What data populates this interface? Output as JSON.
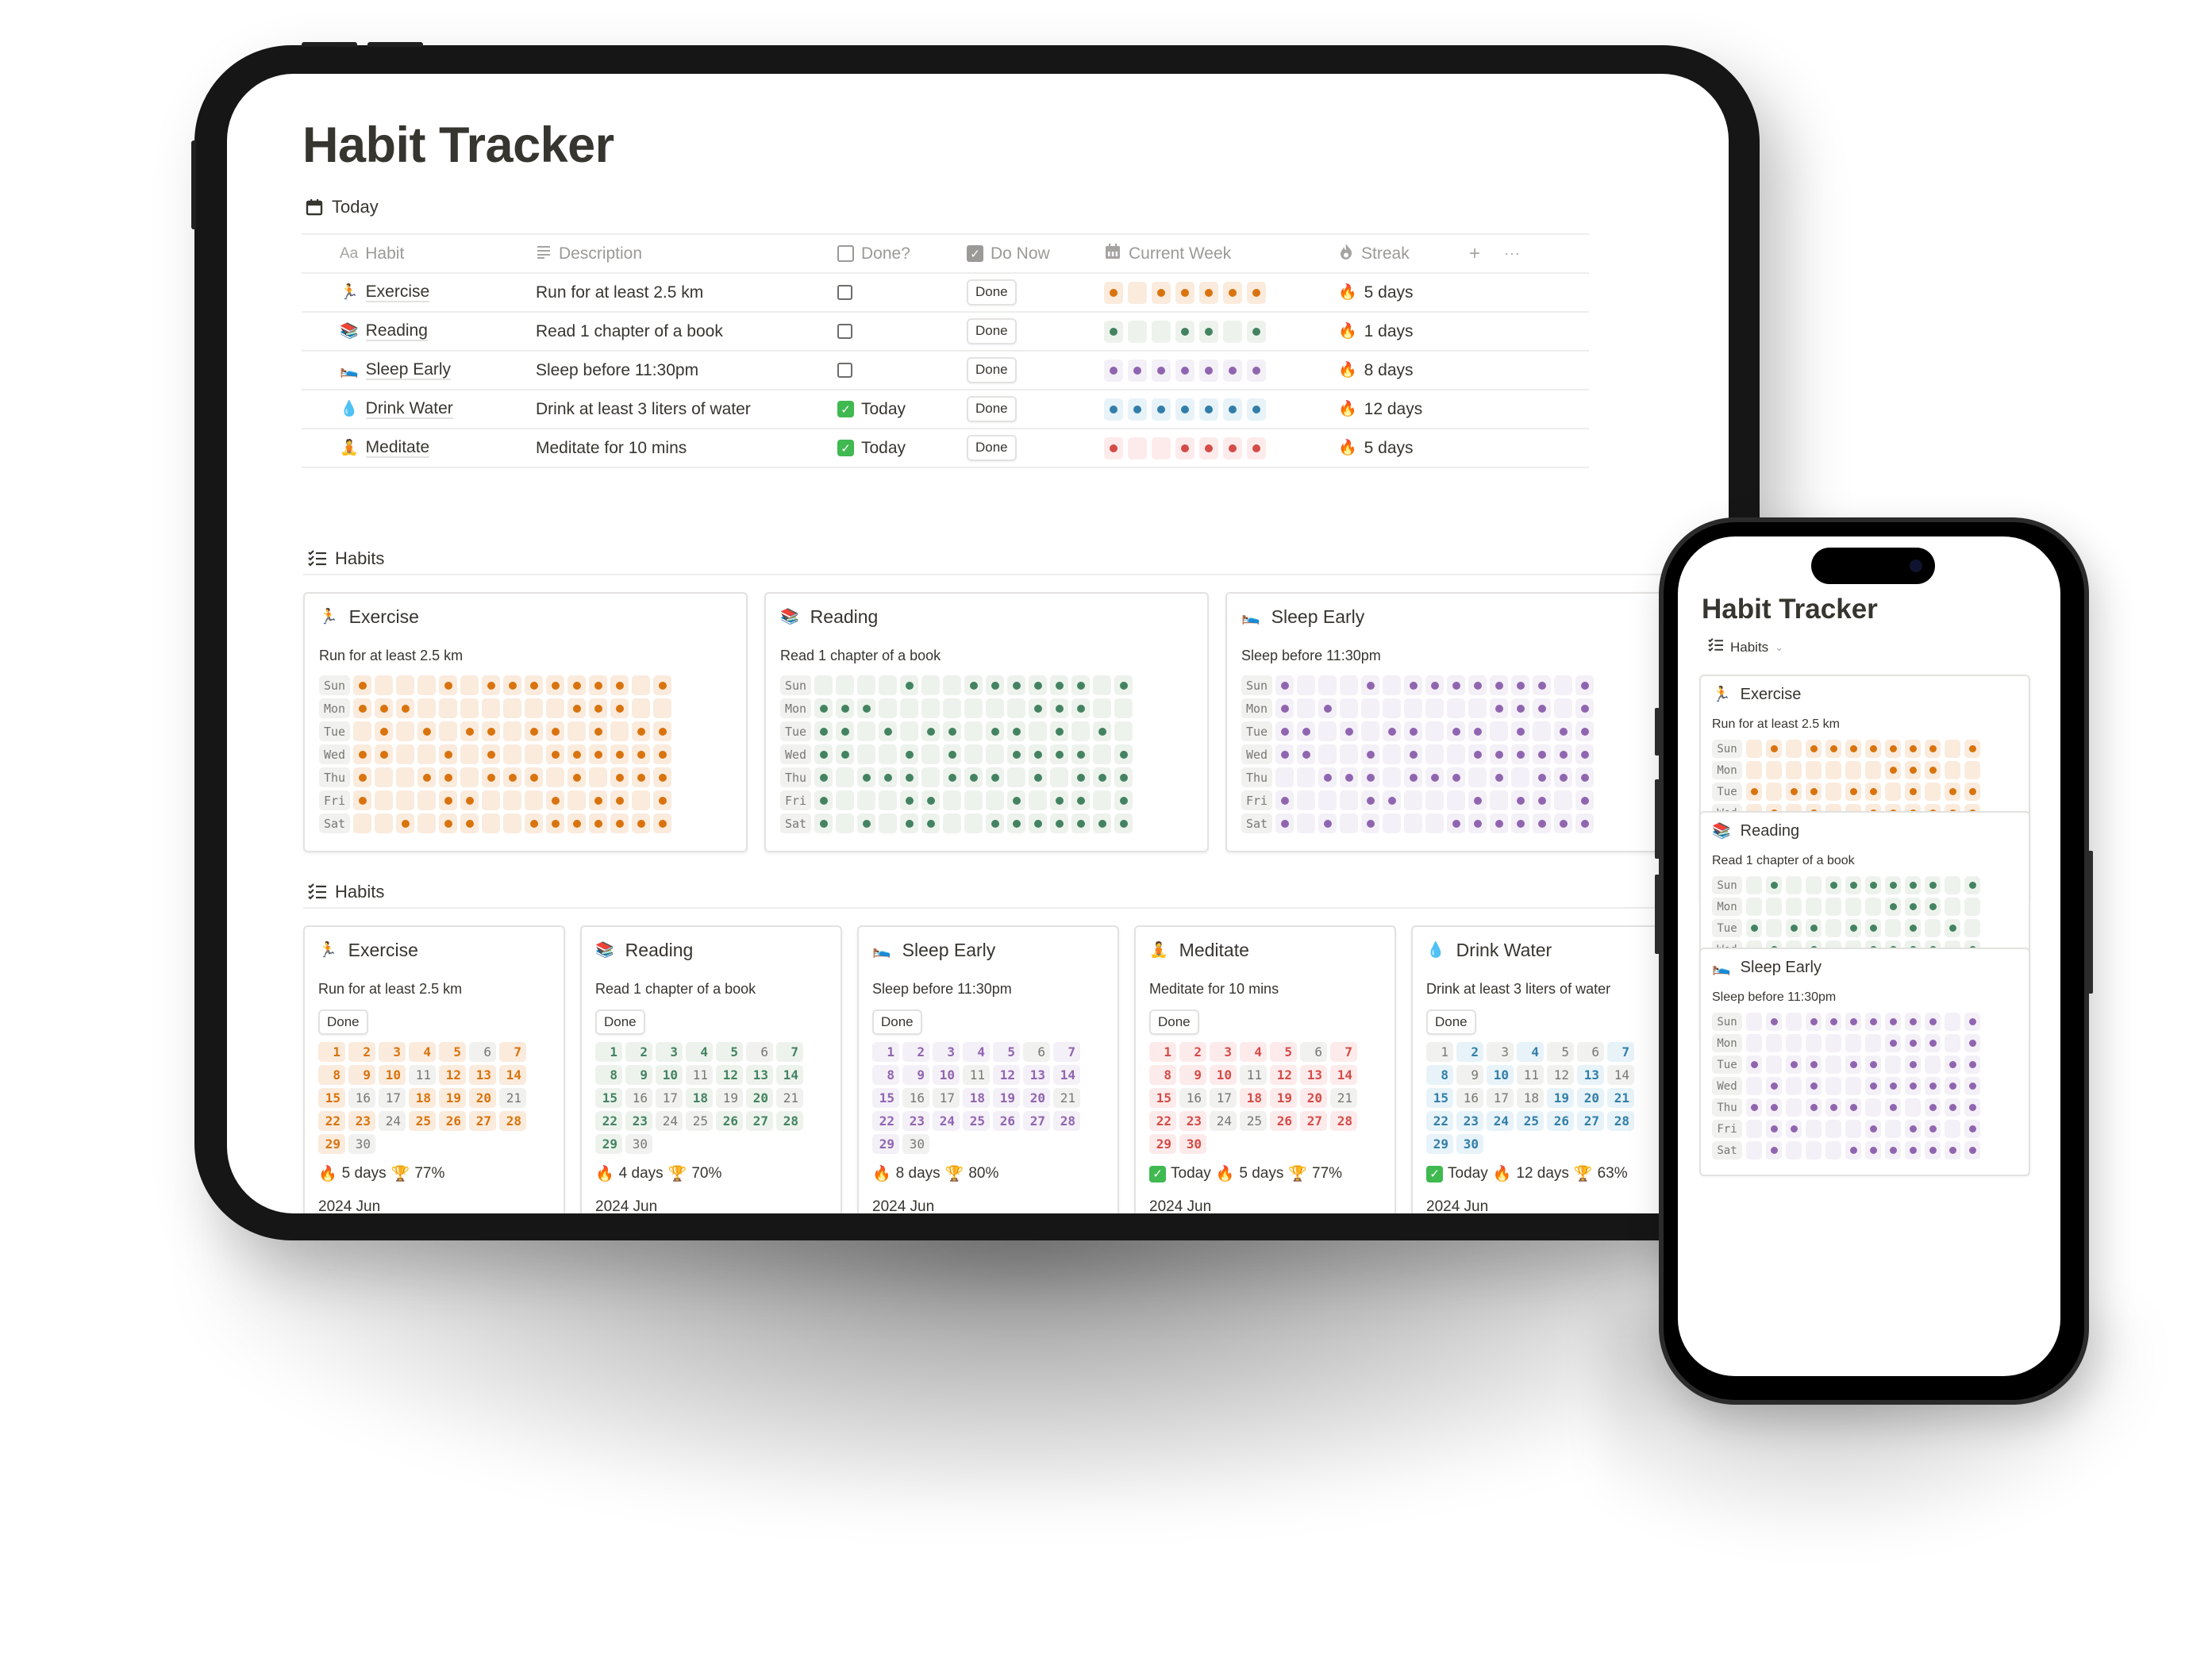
{
  "app_title": "Habit Tracker",
  "colors": {
    "orange": {
      "dot": "#d9730d",
      "bg": "#faebdd",
      "text": "#d9730d"
    },
    "green": {
      "dot": "#448361",
      "bg": "#edf3ec",
      "text": "#448361"
    },
    "purple": {
      "dot": "#9065b0",
      "bg": "#f4f0f7",
      "text": "#9065b0"
    },
    "blue": {
      "dot": "#337ea9",
      "bg": "#e7f3f8",
      "text": "#337ea9"
    },
    "red": {
      "dot": "#d44c47",
      "bg": "#fdebec",
      "text": "#d44c47"
    },
    "neutral_bg": "#f1f1ef",
    "neutral_text": "#787774"
  },
  "today": {
    "section_label": "Today",
    "section_icon": "calendar-icon",
    "columns": [
      {
        "key": "habit",
        "label": "Habit",
        "icon": "Aa"
      },
      {
        "key": "description",
        "label": "Description",
        "icon": "lines-icon"
      },
      {
        "key": "done",
        "label": "Done?",
        "icon": "checkbox-icon"
      },
      {
        "key": "do_now",
        "label": "Do Now",
        "icon": "checked-box-icon"
      },
      {
        "key": "current_week",
        "label": "Current Week",
        "icon": "calendar-grid-icon"
      },
      {
        "key": "streak",
        "label": "Streak",
        "icon": "fire-icon"
      }
    ],
    "add_column": "+",
    "more": "···",
    "rows": [
      {
        "emoji": "🏃",
        "habit": "Exercise",
        "description": "Run for at least 2.5 km",
        "done": false,
        "done_label": "",
        "do_now": "Done",
        "color": "orange",
        "week": [
          1,
          0,
          1,
          1,
          1,
          1,
          1
        ],
        "streak": "5 days"
      },
      {
        "emoji": "📚",
        "habit": "Reading",
        "description": "Read 1 chapter of a book",
        "done": false,
        "done_label": "",
        "do_now": "Done",
        "color": "green",
        "week": [
          1,
          0,
          0,
          1,
          1,
          0,
          1
        ],
        "streak": "1 days"
      },
      {
        "emoji": "🛌",
        "habit": "Sleep Early",
        "description": "Sleep before 11:30pm",
        "done": false,
        "done_label": "",
        "do_now": "Done",
        "color": "purple",
        "week": [
          1,
          1,
          1,
          1,
          1,
          1,
          1
        ],
        "streak": "8 days"
      },
      {
        "emoji": "💧",
        "habit": "Drink Water",
        "description": "Drink at least 3 liters of water",
        "done": true,
        "done_label": "Today",
        "do_now": "Done",
        "color": "blue",
        "week": [
          1,
          1,
          1,
          1,
          1,
          1,
          1
        ],
        "streak": "12 days"
      },
      {
        "emoji": "🧘",
        "habit": "Meditate",
        "description": "Meditate for 10 mins",
        "done": true,
        "done_label": "Today",
        "do_now": "Done",
        "color": "red",
        "week": [
          1,
          0,
          0,
          1,
          1,
          1,
          1
        ],
        "streak": "5 days"
      }
    ]
  },
  "habits_grid": {
    "section_label": "Habits",
    "weekdays": [
      "Sun",
      "Mon",
      "Tue",
      "Wed",
      "Thu",
      "Fri",
      "Sat"
    ],
    "cards": [
      {
        "emoji": "🏃",
        "title": "Exercise",
        "description": "Run for at least 2.5 km",
        "color": "orange",
        "grid": [
          [
            1,
            0,
            0,
            0,
            1,
            0,
            1,
            1,
            1,
            1,
            1,
            1,
            1,
            0,
            1
          ],
          [
            1,
            1,
            1,
            0,
            0,
            0,
            0,
            0,
            0,
            0,
            1,
            1,
            1,
            0,
            0
          ],
          [
            0,
            1,
            0,
            1,
            0,
            1,
            1,
            0,
            1,
            1,
            0,
            1,
            0,
            1,
            1
          ],
          [
            1,
            1,
            0,
            0,
            1,
            0,
            1,
            0,
            0,
            1,
            1,
            1,
            1,
            1,
            1
          ],
          [
            1,
            0,
            0,
            1,
            1,
            0,
            1,
            1,
            1,
            0,
            1,
            0,
            1,
            1,
            1
          ],
          [
            1,
            0,
            0,
            0,
            1,
            1,
            0,
            0,
            0,
            1,
            0,
            1,
            1,
            0,
            1
          ],
          [
            0,
            0,
            1,
            0,
            1,
            1,
            0,
            0,
            1,
            1,
            1,
            1,
            1,
            1,
            1
          ]
        ]
      },
      {
        "emoji": "📚",
        "title": "Reading",
        "description": "Read 1 chapter of a book",
        "color": "green",
        "grid": [
          [
            0,
            0,
            0,
            0,
            1,
            0,
            0,
            1,
            1,
            1,
            1,
            1,
            1,
            0,
            1
          ],
          [
            1,
            1,
            1,
            0,
            0,
            0,
            0,
            0,
            0,
            0,
            1,
            1,
            1,
            0,
            0
          ],
          [
            1,
            1,
            0,
            1,
            0,
            1,
            1,
            0,
            1,
            1,
            0,
            1,
            0,
            1,
            0
          ],
          [
            1,
            1,
            0,
            0,
            1,
            0,
            1,
            0,
            0,
            1,
            1,
            1,
            1,
            0,
            1
          ],
          [
            1,
            0,
            1,
            1,
            1,
            0,
            1,
            1,
            1,
            0,
            1,
            0,
            1,
            1,
            1
          ],
          [
            1,
            0,
            0,
            0,
            1,
            1,
            0,
            0,
            0,
            1,
            0,
            1,
            1,
            0,
            1
          ],
          [
            1,
            0,
            1,
            0,
            1,
            1,
            0,
            0,
            1,
            1,
            1,
            1,
            1,
            1,
            1
          ]
        ]
      },
      {
        "emoji": "🛌",
        "title": "Sleep Early",
        "description": "Sleep before 11:30pm",
        "color": "purple",
        "grid": [
          [
            1,
            0,
            0,
            0,
            1,
            0,
            1,
            1,
            1,
            1,
            1,
            1,
            1,
            0,
            1
          ],
          [
            1,
            0,
            1,
            0,
            0,
            0,
            0,
            0,
            0,
            0,
            1,
            1,
            1,
            0,
            1
          ],
          [
            1,
            1,
            0,
            1,
            0,
            1,
            1,
            0,
            1,
            1,
            0,
            1,
            0,
            1,
            1
          ],
          [
            1,
            1,
            0,
            0,
            1,
            0,
            1,
            0,
            0,
            1,
            1,
            1,
            1,
            1,
            1
          ],
          [
            0,
            0,
            1,
            1,
            1,
            0,
            1,
            1,
            1,
            0,
            1,
            0,
            1,
            1,
            1
          ],
          [
            1,
            0,
            0,
            0,
            1,
            1,
            0,
            0,
            0,
            1,
            0,
            1,
            1,
            0,
            1
          ],
          [
            1,
            0,
            1,
            0,
            1,
            0,
            0,
            0,
            1,
            1,
            1,
            1,
            1,
            1,
            1
          ]
        ]
      }
    ]
  },
  "habits_calendar": {
    "section_label": "Habits",
    "button_label": "Done",
    "month_label": "2024 Jun",
    "days_in_month": 30,
    "cards": [
      {
        "emoji": "🏃",
        "title": "Exercise",
        "description": "Run for at least 2.5 km",
        "color": "orange",
        "done_days": [
          1,
          2,
          3,
          4,
          5,
          7,
          8,
          9,
          10,
          12,
          13,
          14,
          15,
          18,
          19,
          20,
          22,
          23,
          25,
          26,
          27,
          28,
          29
        ],
        "today_label": "",
        "streak": "5 days",
        "rate": "77%"
      },
      {
        "emoji": "📚",
        "title": "Reading",
        "description": "Read 1 chapter of a book",
        "color": "green",
        "done_days": [
          1,
          2,
          3,
          4,
          5,
          7,
          8,
          9,
          10,
          12,
          13,
          14,
          15,
          18,
          20,
          22,
          23,
          26,
          27,
          28,
          29
        ],
        "today_label": "",
        "streak": "4 days",
        "rate": "70%"
      },
      {
        "emoji": "🛌",
        "title": "Sleep Early",
        "description": "Sleep before 11:30pm",
        "color": "purple",
        "done_days": [
          1,
          2,
          3,
          4,
          5,
          7,
          8,
          9,
          10,
          12,
          13,
          14,
          15,
          18,
          19,
          20,
          22,
          23,
          24,
          25,
          26,
          27,
          28,
          29
        ],
        "today_label": "",
        "streak": "8 days",
        "rate": "80%"
      },
      {
        "emoji": "🧘",
        "title": "Meditate",
        "description": "Meditate for 10 mins",
        "color": "red",
        "done_days": [
          1,
          2,
          3,
          4,
          5,
          7,
          8,
          9,
          10,
          12,
          13,
          14,
          15,
          18,
          19,
          20,
          22,
          23,
          26,
          27,
          28,
          29,
          30
        ],
        "today_label": "Today",
        "streak": "5 days",
        "rate": "77%"
      },
      {
        "emoji": "💧",
        "title": "Drink Water",
        "description": "Drink at least 3 liters of water",
        "color": "blue",
        "done_days": [
          2,
          4,
          7,
          8,
          10,
          13,
          15,
          19,
          20,
          21,
          22,
          23,
          24,
          25,
          26,
          27,
          28,
          29,
          30
        ],
        "today_label": "Today",
        "streak": "12 days",
        "rate": "63%"
      }
    ]
  },
  "phone": {
    "title": "Habit Tracker",
    "view_label": "Habits",
    "cards": [
      {
        "emoji": "🏃",
        "title": "Exercise",
        "description": "Run for at least 2.5 km",
        "color": "orange",
        "grid": [
          [
            0,
            1,
            0,
            1,
            1,
            1,
            1,
            1,
            1,
            1,
            0,
            1
          ],
          [
            0,
            0,
            0,
            0,
            0,
            0,
            0,
            1,
            1,
            1,
            0,
            0
          ],
          [
            1,
            0,
            1,
            1,
            0,
            1,
            1,
            0,
            1,
            0,
            1,
            1
          ],
          [
            0,
            1,
            0,
            1,
            0,
            0,
            1,
            1,
            1,
            1,
            1,
            1
          ],
          [
            1,
            1,
            0,
            1,
            1,
            1,
            0,
            1,
            0,
            1,
            1,
            1
          ],
          [
            0,
            1,
            1,
            0,
            0,
            0,
            1,
            0,
            1,
            1,
            0,
            1
          ],
          [
            0,
            1,
            1,
            0,
            0,
            1,
            1,
            1,
            1,
            1,
            1,
            1
          ]
        ]
      },
      {
        "emoji": "📚",
        "title": "Reading",
        "description": "Read 1 chapter of a book",
        "color": "green",
        "grid": [
          [
            0,
            1,
            0,
            0,
            1,
            1,
            1,
            1,
            1,
            1,
            0,
            1
          ],
          [
            0,
            0,
            0,
            0,
            0,
            0,
            0,
            1,
            1,
            1,
            0,
            0
          ],
          [
            1,
            0,
            1,
            1,
            0,
            1,
            1,
            0,
            1,
            0,
            1,
            0
          ],
          [
            0,
            1,
            0,
            1,
            0,
            0,
            1,
            1,
            1,
            1,
            0,
            1
          ],
          [
            1,
            1,
            0,
            1,
            1,
            1,
            0,
            1,
            0,
            1,
            1,
            1
          ],
          [
            0,
            1,
            1,
            0,
            0,
            0,
            1,
            0,
            1,
            1,
            0,
            0
          ],
          [
            0,
            1,
            1,
            0,
            0,
            1,
            1,
            1,
            1,
            1,
            1,
            1
          ]
        ]
      },
      {
        "emoji": "🛌",
        "title": "Sleep Early",
        "description": "Sleep before 11:30pm",
        "color": "purple",
        "grid": [
          [
            0,
            1,
            0,
            1,
            1,
            1,
            1,
            1,
            1,
            1,
            0,
            1
          ],
          [
            0,
            0,
            0,
            0,
            0,
            0,
            0,
            1,
            1,
            1,
            0,
            1
          ],
          [
            1,
            0,
            1,
            1,
            0,
            1,
            1,
            0,
            1,
            0,
            1,
            1
          ],
          [
            0,
            1,
            0,
            1,
            0,
            0,
            1,
            1,
            1,
            1,
            1,
            1
          ],
          [
            1,
            1,
            0,
            1,
            1,
            1,
            0,
            1,
            0,
            1,
            1,
            1
          ],
          [
            0,
            1,
            1,
            0,
            0,
            0,
            1,
            0,
            1,
            1,
            0,
            1
          ],
          [
            0,
            1,
            0,
            0,
            0,
            1,
            1,
            1,
            1,
            1,
            1,
            1
          ]
        ]
      }
    ]
  }
}
